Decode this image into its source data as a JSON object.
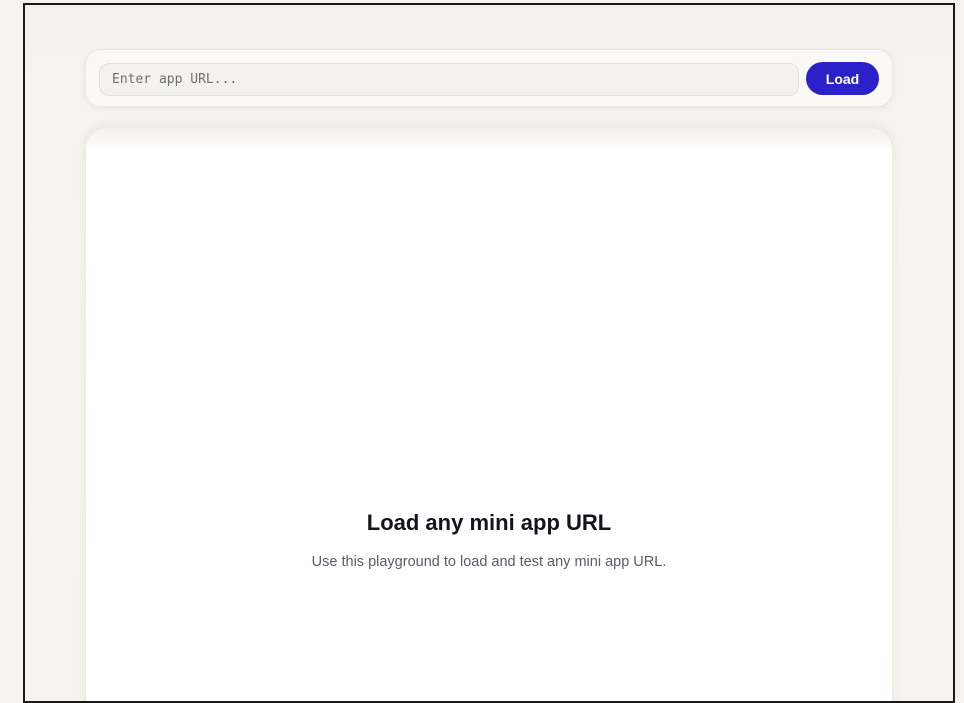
{
  "url_bar": {
    "input_value": "",
    "input_placeholder": "Enter app URL...",
    "load_label": "Load"
  },
  "empty_state": {
    "title": "Load any mini app URL",
    "description": "Use this playground to load and test any mini app URL."
  },
  "colors": {
    "accent": "#2a21c9",
    "background": "#f6f3ee",
    "panel": "#ffffff"
  }
}
